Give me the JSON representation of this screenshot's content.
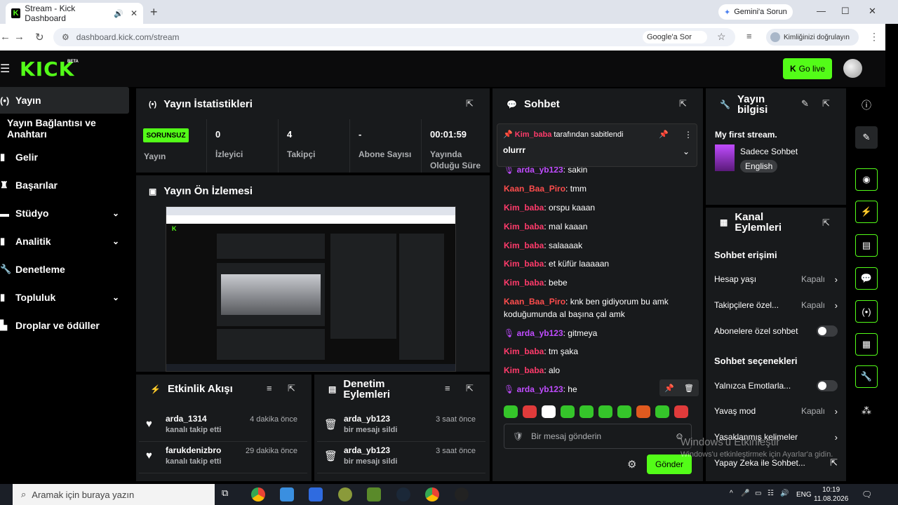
{
  "browser": {
    "tab_title": "Stream - Kick Dashboard",
    "url": "dashboard.kick.com/stream",
    "gemini_label": "Gemini'a Sorun",
    "google_sor_label": "Google'a Sor",
    "identity_label": "Kimliğinizi doğrulayın"
  },
  "app": {
    "logo": "KICK",
    "beta": "BETA",
    "go_live": "Go live",
    "accent": "#53fc18"
  },
  "sidebar": {
    "items": [
      {
        "label": "Yayın",
        "icon": "broadcast-icon"
      },
      {
        "label": "Yayın Bağlantısı ve Anahtarı",
        "icon": ""
      },
      {
        "label": "Gelir",
        "icon": "chart-icon"
      },
      {
        "label": "Başarılar",
        "icon": "trophy-icon"
      },
      {
        "label": "Stüdyo",
        "icon": "studio-icon"
      },
      {
        "label": "Analitik",
        "icon": "analytics-icon"
      },
      {
        "label": "Denetleme",
        "icon": "wrench-icon"
      },
      {
        "label": "Topluluk",
        "icon": "community-icon"
      },
      {
        "label": "Droplar ve ödüller",
        "icon": "gift-icon"
      }
    ]
  },
  "stats": {
    "title": "Yayın İstatistikleri",
    "status_badge": "SORUNSUZ",
    "status_label": "Yayın",
    "viewers": {
      "value": "0",
      "label": "İzleyici"
    },
    "followers": {
      "value": "4",
      "label": "Takipçi"
    },
    "subs": {
      "value": "-",
      "label": "Abone Sayısı"
    },
    "duration": {
      "value": "00:01:59",
      "label": "Yayında Olduğu Süre"
    }
  },
  "preview": {
    "title": "Yayın Ön İzlemesi"
  },
  "activity": {
    "title": "Etkinlik Akışı",
    "rows": [
      {
        "name": "arda_1314",
        "sub": "kanalı takip etti",
        "time": "4 dakika önce"
      },
      {
        "name": "farukdenizbro",
        "sub": "kanalı takip etti",
        "time": "29 dakika önce"
      }
    ]
  },
  "moderation": {
    "title": "Denetim Eylemleri",
    "rows": [
      {
        "name": "arda_yb123",
        "sub": "bir mesajı sildi",
        "time": "3 saat önce"
      },
      {
        "name": "arda_yb123",
        "sub": "bir mesajı sildi",
        "time": "3 saat önce"
      }
    ]
  },
  "chat": {
    "title": "Sohbet",
    "pinned_by": "Kim_baba",
    "pinned_suffix": "tarafından sabitlendi",
    "pinned_text": "olurrr",
    "messages": [
      {
        "user": "arda_yb123",
        "text": "sakin",
        "color": "#c04cff",
        "mic": true
      },
      {
        "user": "Kaan_Baa_Piro",
        "text": "tmm",
        "color": "#ff4d4d"
      },
      {
        "user": "Kim_baba",
        "text": "orspu kaaan",
        "color": "#ff3b6b"
      },
      {
        "user": "Kim_baba",
        "text": "mal kaaan",
        "color": "#ff3b6b"
      },
      {
        "user": "Kim_baba",
        "text": "salaaaak",
        "color": "#ff3b6b"
      },
      {
        "user": "Kim_baba",
        "text": "et küfür laaaaan",
        "color": "#ff3b6b"
      },
      {
        "user": "Kim_baba",
        "text": "bebe",
        "color": "#ff3b6b"
      },
      {
        "user": "Kaan_Baa_Piro",
        "text": "knk ben gidiyorum bu amk koduğumunda al başına çal amk",
        "color": "#ff4d4d"
      },
      {
        "user": "arda_yb123",
        "text": "gitmeya",
        "color": "#c04cff",
        "mic": true
      },
      {
        "user": "Kim_baba",
        "text": "tm şaka",
        "color": "#ff3b6b"
      },
      {
        "user": "Kim_baba",
        "text": "alo",
        "color": "#ff3b6b"
      },
      {
        "user": "arda_yb123",
        "text": "he",
        "color": "#c04cff",
        "mic": true
      }
    ],
    "input_placeholder": "Bir mesaj gönderin",
    "send_label": "Gönder"
  },
  "stream_info": {
    "title": "Yayın bilgisi",
    "stream_title": "My first stream.",
    "category": "Sadece Sohbet",
    "language": "English"
  },
  "channel_actions": {
    "title": "Kanal Eylemleri",
    "chat_access": "Sohbet erişimi",
    "account_age": {
      "label": "Hesap yaşı",
      "value": "Kapalı"
    },
    "followers_only": {
      "label": "Takipçilere özel...",
      "value": "Kapalı"
    },
    "subs_only": {
      "label": "Abonelere özel sohbet"
    },
    "chat_options": "Sohbet seçenekleri",
    "emote_only": {
      "label": "Yalnızca Emotlarla..."
    },
    "slow_mode": {
      "label": "Yavaş mod",
      "value": "Kapalı"
    },
    "banned_words": {
      "label": "Yasaklanmış kelimeler"
    },
    "ai_chat": {
      "label": "Yapay Zeka ile Sohbet..."
    }
  },
  "os": {
    "search_placeholder": "Aramak için buraya yazın",
    "lang": "ENG",
    "time": "10:19",
    "date": "11.08.2026",
    "watermark_title": "Windows'u Etkinleştir",
    "watermark_sub": "Windows'u etkinleştirmek için Ayarlar'a gidin."
  }
}
